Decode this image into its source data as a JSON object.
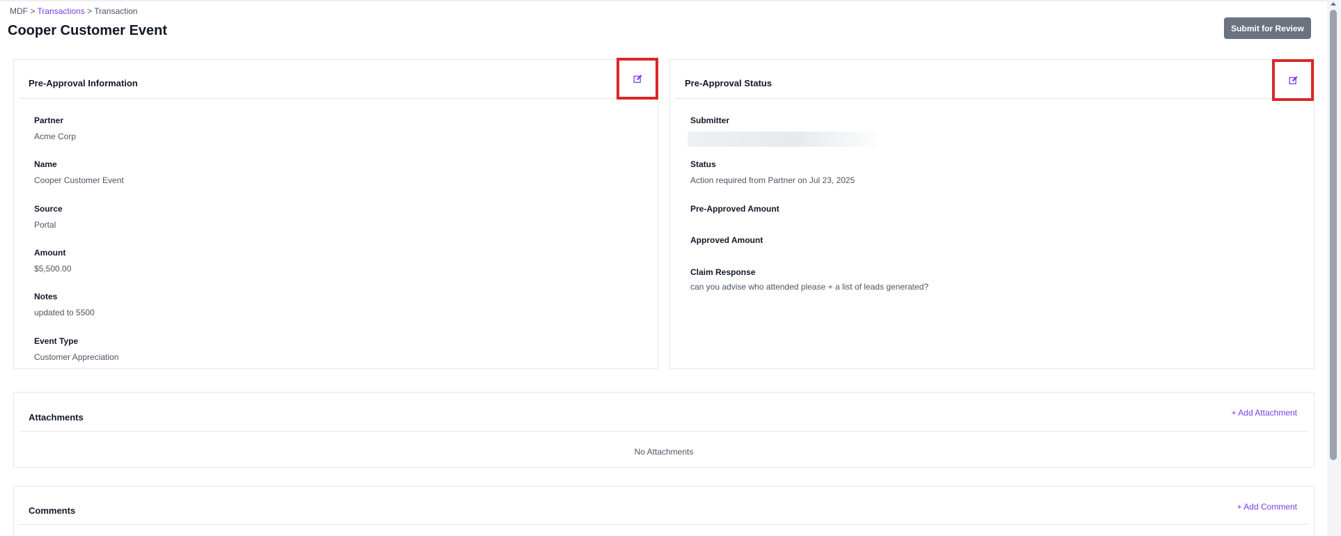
{
  "breadcrumb": {
    "root": "MDF",
    "sep1": ">",
    "link": "Transactions",
    "sep2": ">",
    "current": "Transaction"
  },
  "page_title": "Cooper Customer Event",
  "header": {
    "submit_label": "Submit for Review"
  },
  "pre_approval_info": {
    "title": "Pre-Approval Information",
    "fields": [
      {
        "label": "Partner",
        "value": "Acme Corp"
      },
      {
        "label": "Name",
        "value": "Cooper Customer Event"
      },
      {
        "label": "Source",
        "value": "Portal"
      },
      {
        "label": "Amount",
        "value": "$5,500.00"
      },
      {
        "label": "Notes",
        "value": "updated to 5500"
      },
      {
        "label": "Event Type",
        "value": "Customer Appreciation"
      }
    ]
  },
  "pre_approval_status": {
    "title": "Pre-Approval Status",
    "fields": [
      {
        "label": "Submitter",
        "value": ""
      },
      {
        "label": "Status",
        "value": "Action required from Partner on Jul 23, 2025"
      },
      {
        "label": "Pre-Approved Amount",
        "value": ""
      },
      {
        "label": "Approved Amount",
        "value": ""
      },
      {
        "label": "Claim Response",
        "value": "can you advise who attended please + a list of leads generated?"
      }
    ]
  },
  "attachments": {
    "title": "Attachments",
    "add_label": "+ Add Attachment",
    "empty_text": "No Attachments"
  },
  "comments": {
    "title": "Comments",
    "add_label": "+ Add Comment"
  },
  "colors": {
    "accent": "#7c3aed",
    "button_bg": "#6b7280",
    "highlight": "#dc2626",
    "border": "#e5e7eb"
  },
  "icons": {
    "edit": "edit-icon"
  }
}
